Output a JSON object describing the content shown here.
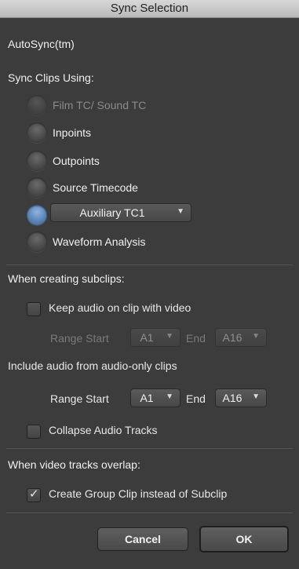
{
  "window": {
    "title": "Sync Selection"
  },
  "header": {
    "autosync_label": "AutoSync(tm)"
  },
  "sync_clips": {
    "heading": "Sync Clips Using:",
    "options": [
      {
        "label": "Film TC/ Sound TC",
        "enabled": false,
        "selected": false
      },
      {
        "label": "Inpoints",
        "enabled": true,
        "selected": false
      },
      {
        "label": "Outpoints",
        "enabled": true,
        "selected": false
      },
      {
        "label": "Source Timecode",
        "enabled": true,
        "selected": false
      },
      {
        "label": "Auxiliary TC1",
        "enabled": true,
        "selected": true,
        "is_dropdown": true
      },
      {
        "label": "Waveform Analysis",
        "enabled": true,
        "selected": false
      }
    ]
  },
  "subclips": {
    "heading": "When creating subclips:",
    "keep_audio": {
      "label": "Keep audio on clip with video",
      "checked": false
    },
    "range1": {
      "start_label": "Range Start",
      "start_value": "A1",
      "end_label": "End",
      "end_value": "A16",
      "enabled": false
    },
    "include_audio_label": "Include audio from audio-only clips",
    "range2": {
      "start_label": "Range Start",
      "start_value": "A1",
      "end_label": "End",
      "end_value": "A16",
      "enabled": true
    },
    "collapse_audio": {
      "label": "Collapse Audio Tracks",
      "checked": false
    }
  },
  "overlap": {
    "heading": "When video tracks overlap:",
    "group_clip": {
      "label": "Create Group Clip instead of Subclip",
      "checked": true
    }
  },
  "buttons": {
    "cancel": "Cancel",
    "ok": "OK"
  }
}
